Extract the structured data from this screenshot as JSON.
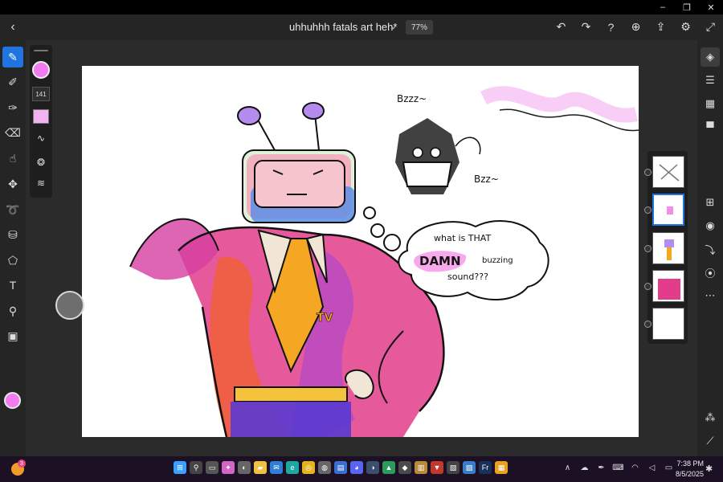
{
  "window": {
    "controls": {
      "minimize": "–",
      "restore": "❐",
      "close": "✕"
    }
  },
  "header": {
    "back_icon": "‹",
    "title": "uhhuhhh fatals art heh*",
    "title_chevron": "⌄",
    "zoom": "77%",
    "actions": [
      {
        "name": "undo-icon",
        "glyph": "↶"
      },
      {
        "name": "redo-icon",
        "glyph": "↷"
      },
      {
        "name": "help-icon",
        "glyph": "?"
      },
      {
        "name": "invite-icon",
        "glyph": "⊕"
      },
      {
        "name": "share-icon",
        "glyph": "⇪"
      },
      {
        "name": "settings-icon",
        "glyph": "⚙"
      },
      {
        "name": "fullscreen-icon",
        "glyph": "⤢"
      }
    ]
  },
  "left_tools": [
    {
      "name": "pixel-brush-tool",
      "glyph": "✎",
      "active": true
    },
    {
      "name": "live-brush-tool",
      "glyph": "✐"
    },
    {
      "name": "vector-brush-tool",
      "glyph": "✑"
    },
    {
      "name": "eraser-tool",
      "glyph": "⌫"
    },
    {
      "name": "smudge-tool",
      "glyph": "☝"
    },
    {
      "name": "move-tool",
      "glyph": "✥"
    },
    {
      "name": "lasso-tool",
      "glyph": "➰"
    },
    {
      "name": "fill-tool",
      "glyph": "⛁"
    },
    {
      "name": "shape-tool",
      "glyph": "⬠"
    },
    {
      "name": "text-tool",
      "glyph": "T"
    },
    {
      "name": "eyedropper-tool",
      "glyph": "⚲"
    },
    {
      "name": "image-tool",
      "glyph": "▣"
    }
  ],
  "brush_panel": {
    "size": "141",
    "icons": [
      {
        "name": "stroke-smoothing-icon",
        "glyph": "∿"
      },
      {
        "name": "brush-settings-icon",
        "glyph": "❂"
      },
      {
        "name": "pressure-settings-icon",
        "glyph": "≋"
      }
    ]
  },
  "right_tools": [
    {
      "name": "layers-icon",
      "glyph": "◈",
      "active": true
    },
    {
      "name": "properties-icon",
      "glyph": "☰"
    },
    {
      "name": "grid-icon",
      "glyph": "▦"
    },
    {
      "name": "comments-icon",
      "glyph": "▀"
    },
    {
      "name": "add-layer-icon",
      "glyph": "⊞"
    },
    {
      "name": "visibility-icon",
      "glyph": "◉"
    },
    {
      "name": "merge-down-icon",
      "glyph": "⤵"
    },
    {
      "name": "blend-mode-icon",
      "glyph": "⦿"
    },
    {
      "name": "more-icon",
      "glyph": "⋯"
    },
    {
      "name": "apps-icon",
      "glyph": "⁂"
    },
    {
      "name": "ruler-icon",
      "glyph": "⟋"
    }
  ],
  "colors": {
    "accent": "#1f74e0",
    "brush_color": "#f27bf0"
  },
  "canvas_text": {
    "bzzz_top": "Bzzz~",
    "bzzz_side": "Bzz~",
    "speech_line1": "what is THAT",
    "speech_damn": "DAMN",
    "speech_buzzing": "buzzing",
    "speech_line3": "sound???",
    "jacket_logo": "TV"
  },
  "taskbar": {
    "badge": "3",
    "apps": [
      {
        "name": "windows-start-icon",
        "glyph": "⊞",
        "color": "#3aa0ff"
      },
      {
        "name": "search-icon",
        "glyph": "⚲",
        "color": "#444"
      },
      {
        "name": "task-view-icon",
        "glyph": "▭",
        "color": "#555"
      },
      {
        "name": "copilot-icon",
        "glyph": "✦",
        "color": "#d266c5"
      },
      {
        "name": "widgets-icon",
        "glyph": "◐",
        "color": "#666"
      },
      {
        "name": "file-explorer-icon",
        "glyph": "▰",
        "color": "#f0c040"
      },
      {
        "name": "mail-icon",
        "glyph": "✉",
        "color": "#2f7dd6"
      },
      {
        "name": "edge-icon",
        "glyph": "e",
        "color": "#1ca7a0"
      },
      {
        "name": "chrome-icon",
        "glyph": "◎",
        "color": "#e6b320"
      },
      {
        "name": "app-icon-1",
        "glyph": "◍",
        "color": "#666"
      },
      {
        "name": "store-icon",
        "glyph": "▤",
        "color": "#3a6fcf"
      },
      {
        "name": "discord-icon",
        "glyph": "◕",
        "color": "#5865f2"
      },
      {
        "name": "steam-icon",
        "glyph": "◑",
        "color": "#3b4e6b"
      },
      {
        "name": "app-icon-2",
        "glyph": "▲",
        "color": "#2b9a5a"
      },
      {
        "name": "app-icon-3",
        "glyph": "◆",
        "color": "#4a4a4a"
      },
      {
        "name": "app-icon-4",
        "glyph": "▥",
        "color": "#b88a3a"
      },
      {
        "name": "app-icon-5",
        "glyph": "▼",
        "color": "#c0392b"
      },
      {
        "name": "app-icon-6",
        "glyph": "▧",
        "color": "#444"
      },
      {
        "name": "app-icon-7",
        "glyph": "▨",
        "color": "#3a7bc8"
      },
      {
        "name": "fresco-icon",
        "glyph": "Fr",
        "color": "#1a2f5a"
      },
      {
        "name": "app-icon-8",
        "glyph": "▦",
        "color": "#e8a020"
      }
    ],
    "tray": [
      {
        "name": "chevron-up-icon",
        "glyph": "∧"
      },
      {
        "name": "cloud-icon",
        "glyph": "☁"
      },
      {
        "name": "pen-icon",
        "glyph": "✒"
      },
      {
        "name": "keyboard-icon",
        "glyph": "⌨"
      },
      {
        "name": "wifi-icon",
        "glyph": "◠"
      },
      {
        "name": "volume-icon",
        "glyph": "◁"
      },
      {
        "name": "battery-icon",
        "glyph": "▭"
      }
    ],
    "time": "7:38 PM",
    "date": "8/5/2025",
    "notifications_icon": "✱"
  }
}
